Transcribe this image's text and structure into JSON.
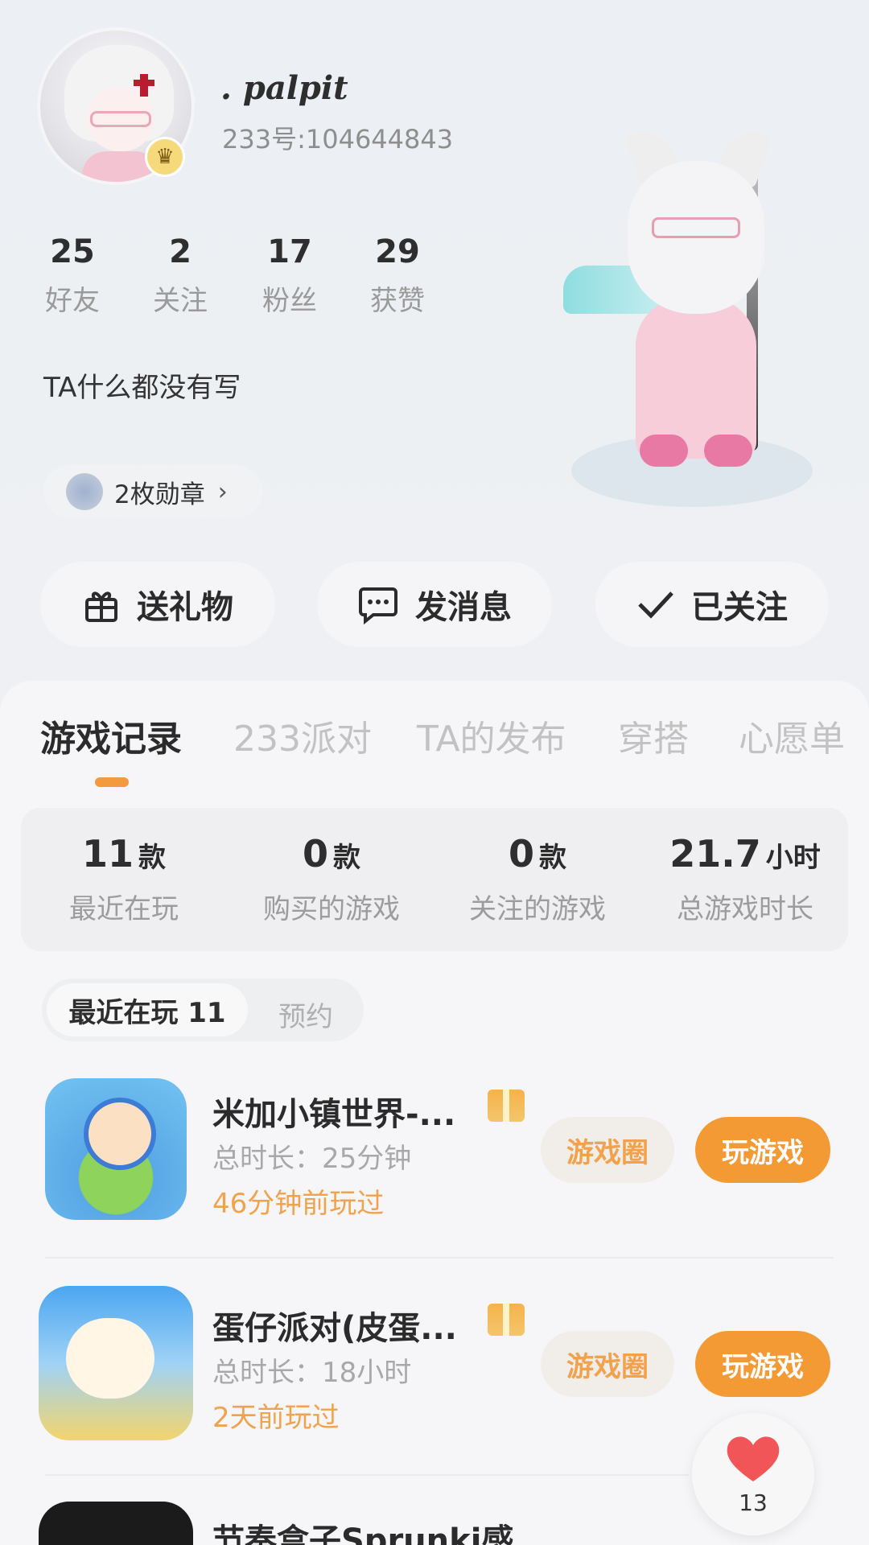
{
  "profile": {
    "username": ". palpit",
    "uid": "233号:104644843",
    "bio": "TA什么都没有写",
    "medals": "2枚勋章"
  },
  "stats": [
    {
      "num": "25",
      "label": "好友"
    },
    {
      "num": "2",
      "label": "关注"
    },
    {
      "num": "17",
      "label": "粉丝"
    },
    {
      "num": "29",
      "label": "获赞"
    }
  ],
  "actions": {
    "gift": "送礼物",
    "message": "发消息",
    "follow": "已关注"
  },
  "tabs": [
    "游戏记录",
    "233派对",
    "TA的发布",
    "穿搭",
    "心愿单"
  ],
  "summary": [
    {
      "val": "11",
      "unit": "款",
      "label": "最近在玩"
    },
    {
      "val": "0",
      "unit": "款",
      "label": "购买的游戏"
    },
    {
      "val": "0",
      "unit": "款",
      "label": "关注的游戏"
    },
    {
      "val": "21.7",
      "unit": "小时",
      "label": "总游戏时长"
    }
  ],
  "subtabs": {
    "active": "最近在玩 11",
    "other": "预约"
  },
  "games": [
    {
      "title": "米加小镇世界-...",
      "duration": "总时长：25分钟",
      "last": "46分钟前玩过",
      "circle": "游戏圈",
      "play": "玩游戏"
    },
    {
      "title": "蛋仔派对(皮蛋...",
      "duration": "总时长：18小时",
      "last": "2天前玩过",
      "circle": "游戏圈",
      "play": "玩游戏"
    },
    {
      "title": "节奏盒子Sprunki感..."
    }
  ],
  "like": {
    "count": "13"
  },
  "colors": {
    "accent": "#f39a35",
    "accent_text": "#f2a24c",
    "heart": "#f25557"
  }
}
